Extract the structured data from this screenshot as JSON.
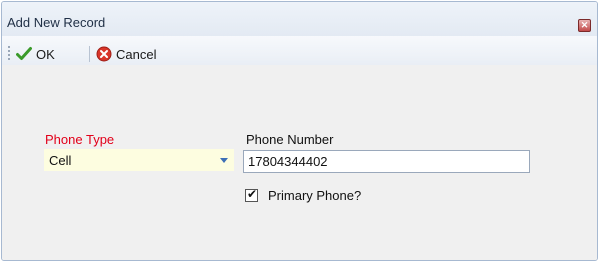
{
  "window": {
    "title": "Add New Record"
  },
  "toolbar": {
    "ok_label": "OK",
    "cancel_label": "Cancel"
  },
  "form": {
    "phone_type_label": "Phone Type",
    "phone_type_value": "Cell",
    "phone_number_label": "Phone Number",
    "phone_number_value": "17804344402",
    "primary_label": "Primary Phone?",
    "primary_checked": true
  },
  "colors": {
    "required_label": "#e2001a",
    "combo_background": "#fdfde0"
  },
  "icons": {
    "ok": "check-icon",
    "cancel": "cancel-icon",
    "close": "close-icon",
    "dropdown": "chevron-down-icon"
  }
}
